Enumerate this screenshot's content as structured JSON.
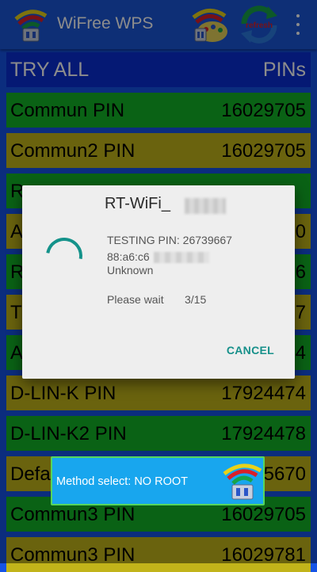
{
  "appbar": {
    "title": "WiFree WPS",
    "actions": [
      {
        "name": "pin-palette-icon"
      },
      {
        "name": "refresh-icon",
        "label": "refresh"
      },
      {
        "name": "overflow-menu-icon"
      }
    ]
  },
  "list": {
    "header": {
      "left": "TRY ALL",
      "right": "PINs"
    },
    "rows": [
      {
        "name": "Commun PIN",
        "pin": "16029705",
        "color": "#13b327"
      },
      {
        "name": "Commun2 PIN",
        "pin": "16029705",
        "color": "#c2b41a"
      },
      {
        "name": "R",
        "pin": "",
        "color": "#13b327"
      },
      {
        "name": "A",
        "pin": "0",
        "color": "#c2b41a"
      },
      {
        "name": "R",
        "pin": "6",
        "color": "#13b327"
      },
      {
        "name": "T",
        "pin": "7",
        "color": "#c2b41a"
      },
      {
        "name": "A",
        "pin": "4",
        "color": "#13b327"
      },
      {
        "name": "D-LIN-K PIN",
        "pin": "17924474",
        "color": "#c2b41a"
      },
      {
        "name": "D-LIN-K2 PIN",
        "pin": "17924478",
        "color": "#13b327"
      },
      {
        "name": "Defa",
        "pin": "5670",
        "color": "#c2b41a"
      },
      {
        "name": "Commun3 PIN",
        "pin": "16029705",
        "color": "#13b327"
      },
      {
        "name": "Commun3 PIN",
        "pin": "16029781",
        "color": "#c2b41a"
      }
    ]
  },
  "dialog": {
    "title": "RT-WiFi_",
    "testing_pin": "TESTING PIN: 26739667",
    "mac": "88:a6:c6",
    "vendor": "Unknown",
    "wait_label": "Please wait",
    "progress": "3/15",
    "cancel_label": "CANCEL"
  },
  "toast": {
    "text": "Method select: NO ROOT"
  },
  "colors": {
    "appbar": "#1a56d8",
    "header": "#0a2fd4",
    "row_green": "#13b327",
    "row_olive": "#c2b41a",
    "accent": "#16908a",
    "toast": "#18a6ee"
  }
}
